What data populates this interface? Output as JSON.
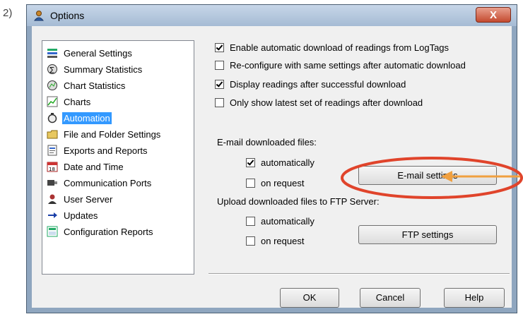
{
  "step_label": "2)",
  "window": {
    "title": "Options",
    "close_label": "X"
  },
  "tree": {
    "items": [
      {
        "label": "General Settings",
        "icon": "general-settings-icon",
        "selected": false
      },
      {
        "label": "Summary Statistics",
        "icon": "summary-statistics-icon",
        "selected": false
      },
      {
        "label": "Chart Statistics",
        "icon": "chart-statistics-icon",
        "selected": false
      },
      {
        "label": "Charts",
        "icon": "charts-icon",
        "selected": false
      },
      {
        "label": "Automation",
        "icon": "automation-icon",
        "selected": true
      },
      {
        "label": "File and Folder Settings",
        "icon": "folder-icon",
        "selected": false
      },
      {
        "label": "Exports and Reports",
        "icon": "exports-icon",
        "selected": false
      },
      {
        "label": "Date and Time",
        "icon": "calendar-icon",
        "selected": false
      },
      {
        "label": "Communication Ports",
        "icon": "ports-icon",
        "selected": false
      },
      {
        "label": "User Server",
        "icon": "user-server-icon",
        "selected": false
      },
      {
        "label": "Updates",
        "icon": "arrow-right-icon",
        "selected": false
      },
      {
        "label": "Configuration Reports",
        "icon": "config-report-icon",
        "selected": false
      }
    ]
  },
  "automation": {
    "enable_auto_download": {
      "label": "Enable automatic download of readings from LogTags",
      "checked": true
    },
    "reconfigure_after": {
      "label": "Re-configure with same settings after automatic download",
      "checked": false
    },
    "display_after": {
      "label": "Display readings after successful download",
      "checked": true
    },
    "only_latest": {
      "label": "Only show latest set of readings after download",
      "checked": false
    },
    "email_section": "E-mail downloaded files:",
    "email_auto": {
      "label": "automatically",
      "checked": true
    },
    "email_request": {
      "label": "on request",
      "checked": false
    },
    "email_settings_button": "E-mail settings",
    "ftp_section": "Upload downloaded files to FTP Server:",
    "ftp_auto": {
      "label": "automatically",
      "checked": false
    },
    "ftp_request": {
      "label": "on request",
      "checked": false
    },
    "ftp_settings_button": "FTP settings"
  },
  "footer": {
    "ok": "OK",
    "cancel": "Cancel",
    "help": "Help"
  },
  "colors": {
    "highlight_circle": "#e0442b",
    "arrow": "#f0a040",
    "selection": "#3399ff"
  }
}
